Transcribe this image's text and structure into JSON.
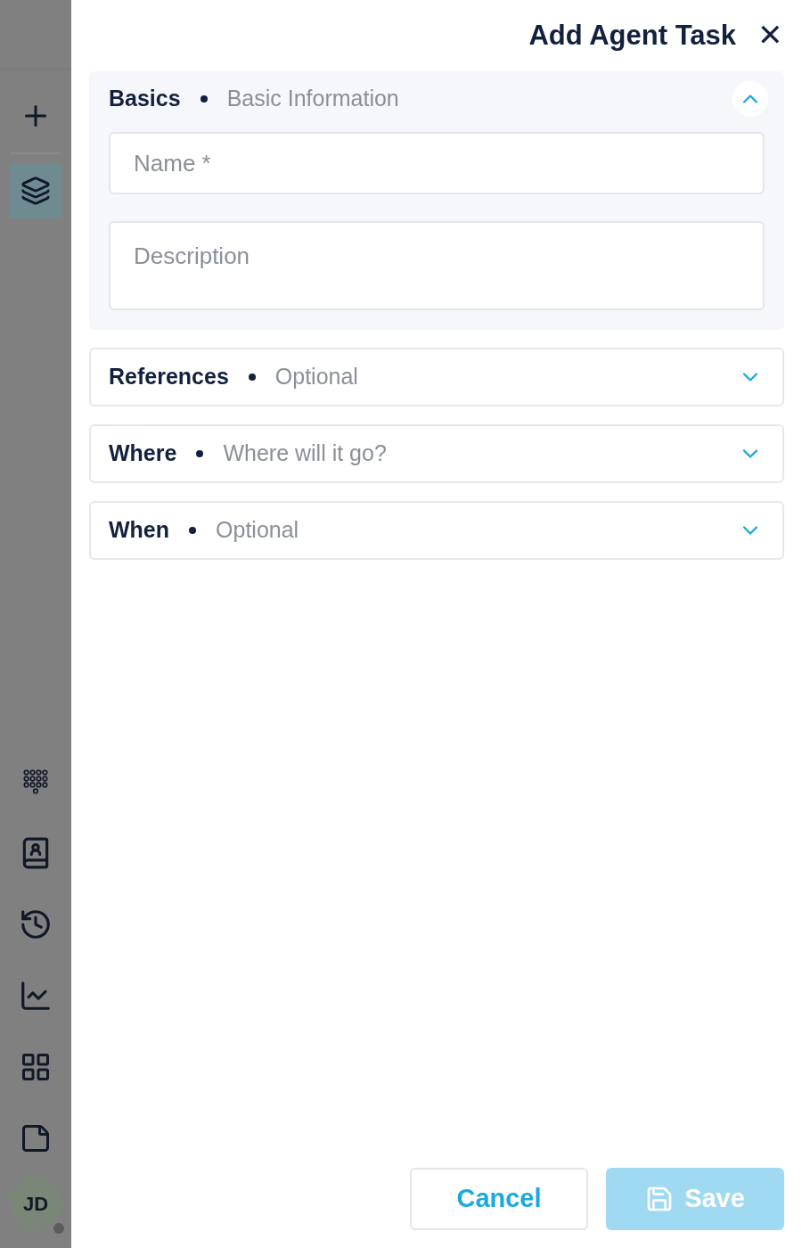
{
  "sidebar": {
    "items": [
      {
        "kind": "add",
        "selected": false
      },
      {
        "kind": "layers",
        "selected": true
      },
      {
        "kind": "dialpad",
        "selected": false
      },
      {
        "kind": "contacts",
        "selected": false
      },
      {
        "kind": "history",
        "selected": false
      },
      {
        "kind": "chart",
        "selected": false
      },
      {
        "kind": "apps",
        "selected": false
      },
      {
        "kind": "note",
        "selected": false
      }
    ],
    "avatar": {
      "initials": "JD"
    }
  },
  "panel": {
    "title": "Add Agent Task",
    "close": "✕"
  },
  "sections": [
    {
      "title": "Basics",
      "subtitle": "Basic Information",
      "expanded": true,
      "fields": [
        {
          "kind": "input",
          "placeholder": "Name *"
        },
        {
          "kind": "textarea",
          "placeholder": "Description"
        }
      ]
    },
    {
      "title": "References",
      "subtitle": "Optional",
      "expanded": false
    },
    {
      "title": "Where",
      "subtitle": "Where will it go?",
      "expanded": false
    },
    {
      "title": "When",
      "subtitle": "Optional",
      "expanded": false
    }
  ],
  "buttons": [
    {
      "kind": "cancel",
      "label": "Cancel",
      "disabled": false
    },
    {
      "kind": "save",
      "label": "Save",
      "disabled": true
    }
  ]
}
